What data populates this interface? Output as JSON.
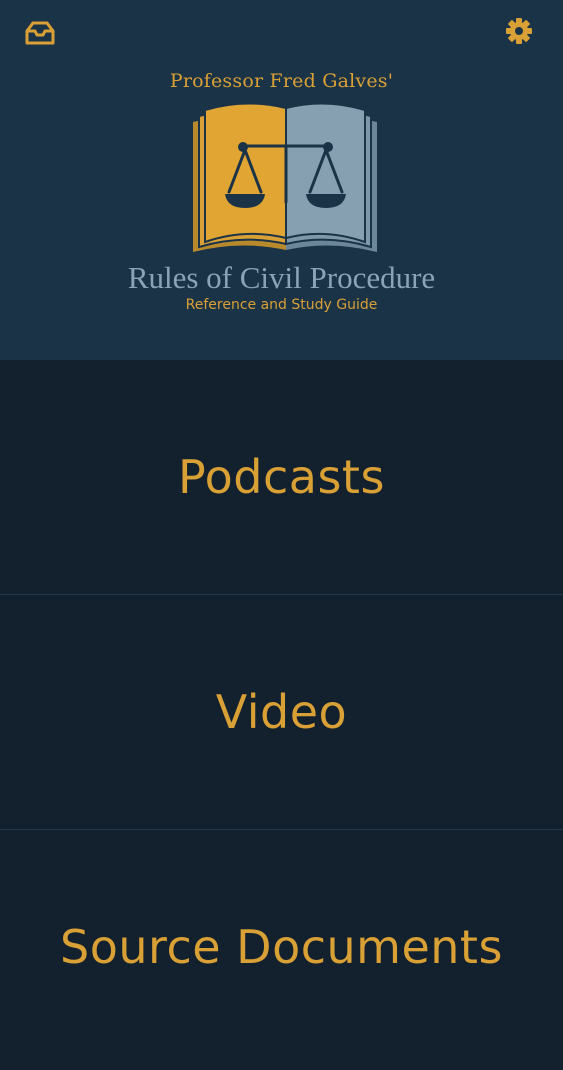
{
  "header": {
    "professor": "Professor Fred Galves'",
    "title": "Rules of Civil Procedure",
    "subtitle": "Reference and Study Guide",
    "inbox_icon": "inbox-icon",
    "settings_icon": "gear-icon"
  },
  "menu": {
    "items": [
      {
        "label": "Podcasts"
      },
      {
        "label": "Video"
      },
      {
        "label": "Source Documents"
      }
    ]
  },
  "colors": {
    "accent": "#d9a035",
    "header_bg": "#1b3347",
    "body_bg": "#13212e",
    "title_text": "#8aa3b6"
  }
}
